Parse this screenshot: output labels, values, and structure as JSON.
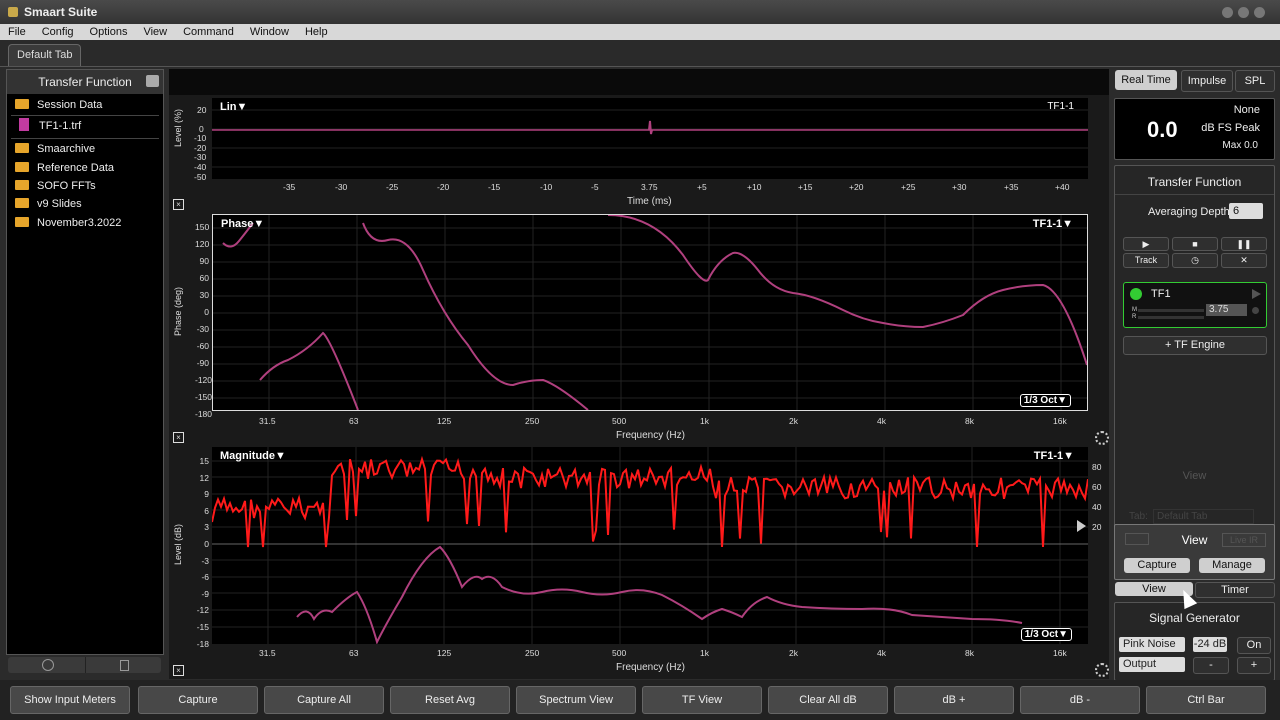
{
  "app": {
    "title": "Smaart Suite"
  },
  "menu": [
    "File",
    "Config",
    "Options",
    "View",
    "Command",
    "Window",
    "Help"
  ],
  "tabs": [
    {
      "label": "Default Tab"
    }
  ],
  "left_panel": {
    "title": "Transfer Function",
    "items": [
      {
        "label": "Session Data",
        "type": "folder"
      },
      {
        "label": "TF1-1.trf",
        "type": "file"
      },
      {
        "label": "Smaarchive",
        "type": "folder"
      },
      {
        "label": "Reference Data",
        "type": "folder"
      },
      {
        "label": "SOFO FFTs",
        "type": "folder"
      },
      {
        "label": "v9 Slides",
        "type": "folder"
      },
      {
        "label": "November3.2022",
        "type": "folder"
      }
    ]
  },
  "plots": {
    "impulse": {
      "label": "Lin▼",
      "trace": "TF1-1",
      "ylabel": "Level (%)",
      "yticks": [
        "20",
        "0",
        "-10",
        "-20",
        "-30",
        "-40",
        "-50"
      ],
      "xlabel": "Time (ms)",
      "xticks": [
        "-35",
        "-30",
        "-25",
        "-20",
        "-15",
        "-10",
        "-5",
        "3.75",
        "+5",
        "+10",
        "+15",
        "+20",
        "+25",
        "+30",
        "+35",
        "+40"
      ]
    },
    "phase": {
      "label": "Phase▼",
      "trace": "TF1-1▼",
      "ylabel": "Phase (deg)",
      "yticks": [
        "150",
        "120",
        "90",
        "60",
        "30",
        "0",
        "-30",
        "-60",
        "-90",
        "-120",
        "-150",
        "-180"
      ],
      "xlabel": "Frequency (Hz)",
      "xticks": [
        "31.5",
        "63",
        "125",
        "250",
        "500",
        "1k",
        "2k",
        "4k",
        "8k",
        "16k"
      ],
      "smoothing": "1/3 Oct▼"
    },
    "magnitude": {
      "label": "Magnitude▼",
      "trace": "TF1-1▼",
      "ylabel": "Level (dB)",
      "yticks": [
        "15",
        "12",
        "9",
        "6",
        "3",
        "0",
        "-3",
        "-6",
        "-9",
        "-12",
        "-15",
        "-18"
      ],
      "rticks": [
        "80",
        "60",
        "40",
        "20"
      ],
      "xlabel": "Frequency (Hz)",
      "xticks": [
        "31.5",
        "63",
        "125",
        "250",
        "500",
        "1k",
        "2k",
        "4k",
        "8k",
        "16k"
      ],
      "smoothing": "1/3 Oct▼"
    }
  },
  "right_panel": {
    "modes": [
      "Real Time",
      "Impulse",
      "SPL"
    ],
    "meter": {
      "value": "0.0",
      "weighting": "None",
      "type": "dB FS Peak",
      "max": "Max 0.0"
    },
    "section_title": "Transfer Function",
    "averaging_label": "Averaging Depth:",
    "averaging_value": "6",
    "track_label": "Track",
    "engine": {
      "name": "TF1",
      "delay": "3.75",
      "m": "M",
      "r": "R"
    },
    "add_engine": "+ TF Engine",
    "view_ghost": "View",
    "tab_ghost_label": "Tab:",
    "tab_ghost_value": "Default Tab",
    "live_ir": "Live IR",
    "view_popup": {
      "title": "View",
      "capture": "Capture",
      "manage": "Manage"
    },
    "view_tab": "View",
    "timer_tab": "Timer",
    "siggen_title": "Signal Generator",
    "siggen_type": "Pink Noise",
    "siggen_level": "-24 dB",
    "siggen_on": "On",
    "siggen_output": "Output",
    "minus": "-",
    "plus": "+"
  },
  "bottom_bar": [
    "Show Input Meters",
    "Capture",
    "Capture All",
    "Reset Avg",
    "Spectrum View",
    "TF View",
    "Clear All dB",
    "dB +",
    "dB -",
    "Ctrl Bar"
  ],
  "colors": {
    "trace": "#b0407e",
    "magnitude_coherence": "#ff1a1a",
    "engine_led": "#33cc33"
  }
}
